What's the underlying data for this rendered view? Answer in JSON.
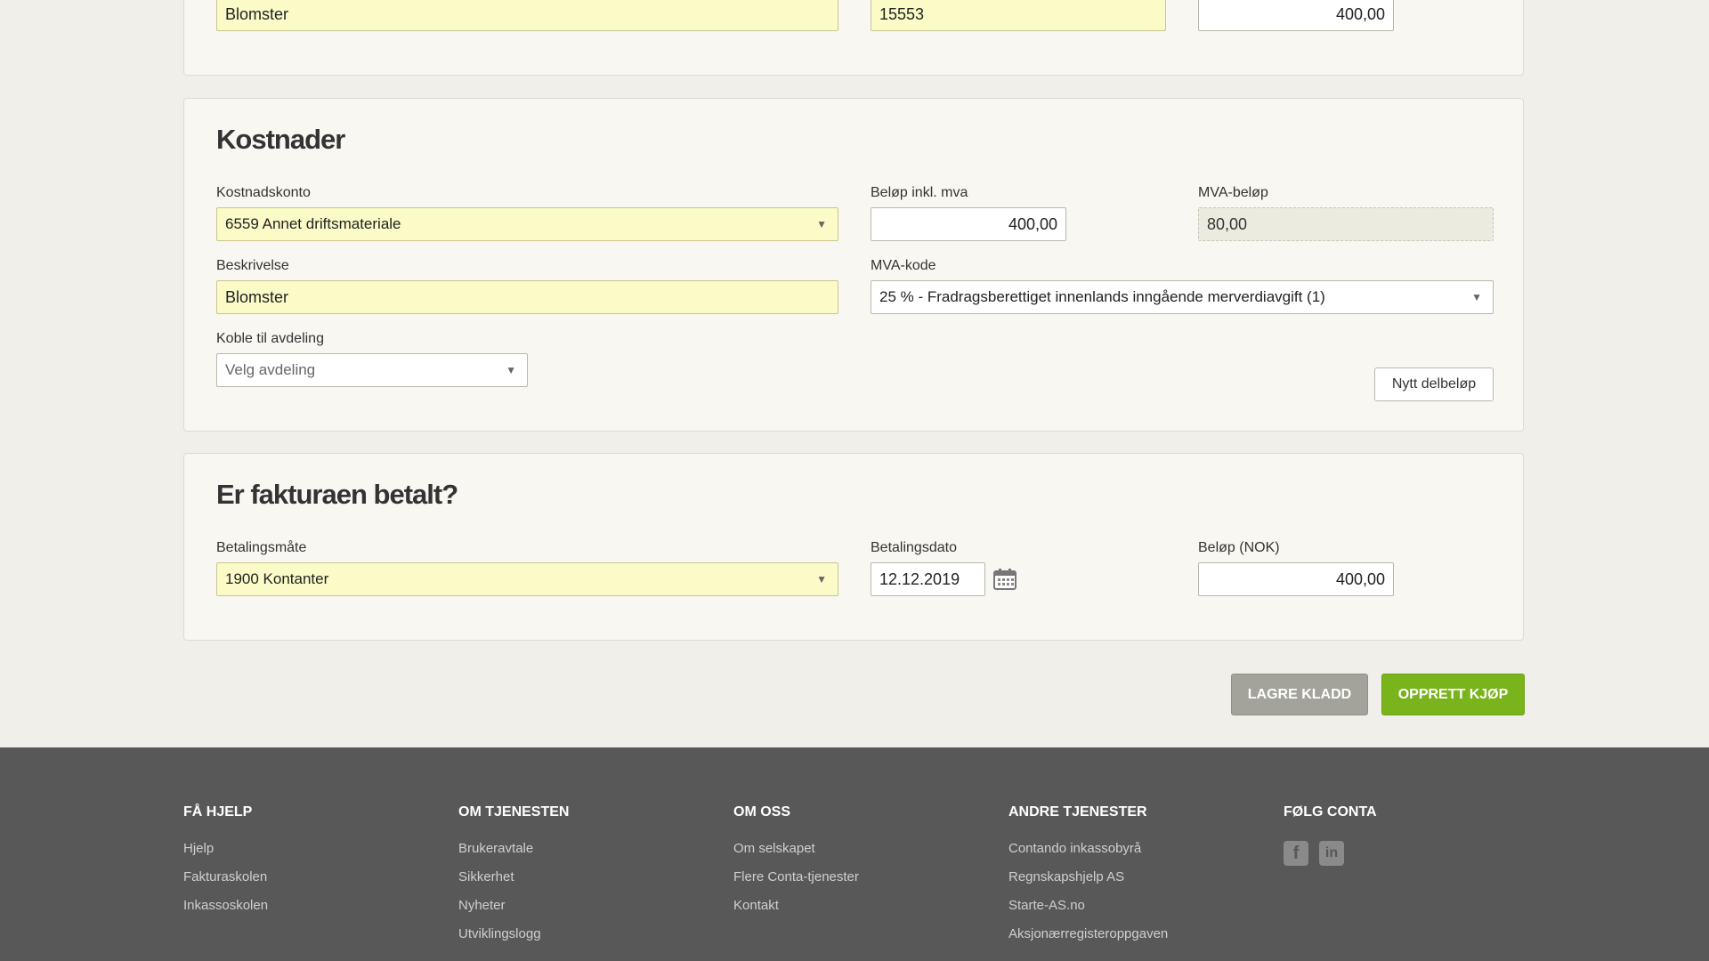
{
  "top_row": {
    "description_value": "Blomster",
    "invoice_value": "15553",
    "amount_value": "400,00"
  },
  "costs": {
    "title": "Kostnader",
    "account_label": "Kostnadskonto",
    "account_value": "6559 Annet driftsmateriale",
    "amount_label": "Beløp inkl. mva",
    "amount_value": "400,00",
    "vat_amount_label": "MVA-beløp",
    "vat_amount_value": "80,00",
    "description_label": "Beskrivelse",
    "description_value": "Blomster",
    "vat_code_label": "MVA-kode",
    "vat_code_value": "25 % - Fradragsberettiget innenlands inngående merverdiavgift (1)",
    "department_label": "Koble til avdeling",
    "department_placeholder": "Velg avdeling",
    "new_partial_button": "Nytt delbeløp"
  },
  "payment": {
    "title": "Er fakturaen betalt?",
    "method_label": "Betalingsmåte",
    "method_value": "1900 Kontanter",
    "date_label": "Betalingsdato",
    "date_value": "12.12.2019",
    "amount_label": "Beløp (NOK)",
    "amount_value": "400,00"
  },
  "actions": {
    "save_draft": "LAGRE KLADD",
    "create_purchase": "OPPRETT KJØP"
  },
  "footer": {
    "columns": [
      {
        "title": "FÅ HJELP",
        "links": [
          "Hjelp",
          "Fakturaskolen",
          "Inkassoskolen"
        ]
      },
      {
        "title": "OM TJENESTEN",
        "links": [
          "Brukeravtale",
          "Sikkerhet",
          "Nyheter",
          "Utviklingslogg"
        ]
      },
      {
        "title": "OM OSS",
        "links": [
          "Om selskapet",
          "Flere Conta-tjenester",
          "Kontakt"
        ]
      },
      {
        "title": "ANDRE TJENESTER",
        "links": [
          "Contando inkassobyrå",
          "Regnskapshjelp AS",
          "Starte-AS.no",
          "Aksjonærregisteroppgaven"
        ]
      },
      {
        "title": "FØLG CONTA",
        "links": []
      }
    ],
    "social_icons": [
      "facebook-icon",
      "linkedin-icon"
    ]
  },
  "colors": {
    "background": "#f0efe9",
    "panel": "#f8f7f2",
    "highlight_field": "#fbfbc8",
    "primary_button": "#7ab41d",
    "secondary_button": "#a3a39c",
    "footer": "#585858"
  }
}
